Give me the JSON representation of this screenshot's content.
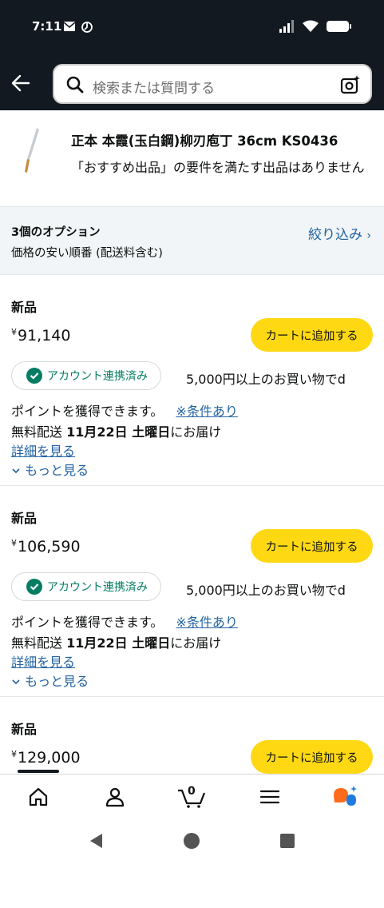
{
  "status": {
    "time": "7:11"
  },
  "search": {
    "placeholder": "検索または質問する"
  },
  "product": {
    "title": "正本 本霞(玉白鋼)柳刃庖丁 36cm KS0436",
    "note": "「おすすめ出品」の要件を満たす出品はありません"
  },
  "options": {
    "heading": "3個のオプション",
    "sort": "価格の安い順番 (配送料含む)",
    "filter": "絞り込み",
    "filter_chevron": "›"
  },
  "offers": [
    {
      "condition": "新品",
      "currency": "¥",
      "price": "91,140",
      "cart_label": "カートに追加する",
      "linked": "アカウント連携済み",
      "promo": "5,000円以上のお買い物でd",
      "points": "ポイントを獲得できます。",
      "conditions_link": "※条件あり",
      "delivery_prefix": "無料配送 ",
      "delivery_date": "11月22日 土曜日",
      "delivery_suffix": "にお届け",
      "details": "詳細を見る",
      "more": "もっと見る"
    },
    {
      "condition": "新品",
      "currency": "¥",
      "price": "106,590",
      "cart_label": "カートに追加する",
      "linked": "アカウント連携済み",
      "promo": "5,000円以上のお買い物でd",
      "points": "ポイントを獲得できます。",
      "conditions_link": "※条件あり",
      "delivery_prefix": "無料配送 ",
      "delivery_date": "11月22日 土曜日",
      "delivery_suffix": "にお届け",
      "details": "詳細を見る",
      "more": "もっと見る"
    },
    {
      "condition": "新品",
      "currency": "¥",
      "price": "129,000",
      "cart_label": "カートに追加する"
    }
  ],
  "tabbar": {
    "cart_count": "0",
    "icons": [
      "home-icon",
      "account-icon",
      "cart-icon",
      "menu-icon",
      "rufus-assistant-icon"
    ]
  },
  "colors": {
    "header_bg": "#131921",
    "cart_button": "#ffd814",
    "link": "#2162a1",
    "linked_green": "#067d62",
    "options_bg": "#f1f5f7"
  }
}
